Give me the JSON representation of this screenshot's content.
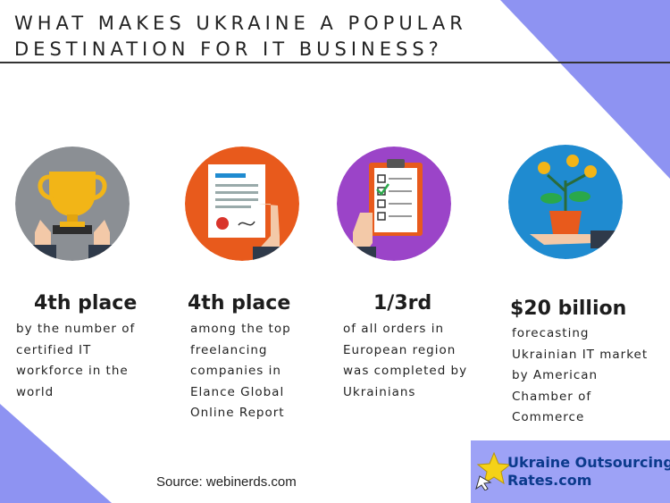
{
  "colors": {
    "accent_purple": "#8e93f2",
    "text": "#222222",
    "circle_gray": "#8b8f94",
    "circle_orange": "#e85a1c",
    "circle_purple": "#9b44c8",
    "circle_blue": "#1f8bd0",
    "logo_bg": "#9da2f6",
    "logo_text": "#0b3a8c"
  },
  "header": {
    "title_line1": "WHAT MAKES UKRAINE A POPULAR",
    "title_line2": "DESTINATION FOR IT BUSINESS?"
  },
  "facts": [
    {
      "icon": "trophy-icon",
      "headline": "4th place",
      "lines": [
        "by the number of",
        "certified IT",
        "workforce in the",
        "world"
      ]
    },
    {
      "icon": "document-icon",
      "headline": "4th place",
      "lines": [
        "among the top",
        "freelancing",
        "companies in",
        "Elance  Global",
        "Online Report"
      ]
    },
    {
      "icon": "clipboard-icon",
      "headline": "1/3rd",
      "lines": [
        "of all orders in",
        "European region",
        "was completed by",
        "Ukrainians"
      ]
    },
    {
      "icon": "money-plant-icon",
      "headline": "$20 billion",
      "lines": [
        "forecasting",
        "Ukrainian IT market",
        "by American",
        "Chamber of",
        "Commerce"
      ]
    }
  ],
  "footer": {
    "source": "Source:  webinerds.com",
    "logo_line1": "Ukraine Outsourcing",
    "logo_line2": "Rates.com",
    "logo_icon": "star-cursor-icon"
  }
}
